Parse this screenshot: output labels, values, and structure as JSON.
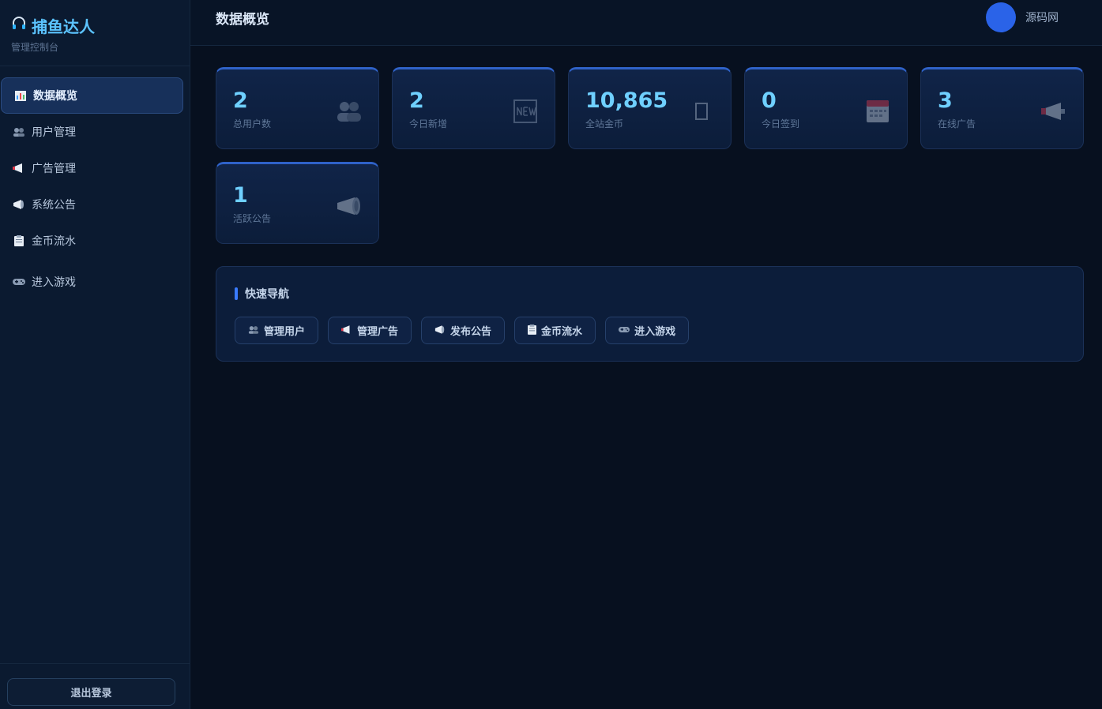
{
  "brand": {
    "title": "捕鱼达人",
    "subtitle": "管理控制台",
    "icon": "headset-icon"
  },
  "sidebar": {
    "items": [
      {
        "label": "数据概览",
        "icon": "chart-icon",
        "active": true
      },
      {
        "label": "用户管理",
        "icon": "users-icon"
      },
      {
        "label": "广告管理",
        "icon": "megaphone-icon"
      },
      {
        "label": "系统公告",
        "icon": "loudspeaker-icon"
      },
      {
        "label": "金币流水",
        "icon": "clipboard-icon"
      },
      {
        "label": "进入游戏",
        "icon": "gamepad-icon"
      }
    ],
    "logout_label": "退出登录"
  },
  "header": {
    "title": "数据概览",
    "username": "源码网"
  },
  "stats": [
    {
      "value": "2",
      "label": "总用户数",
      "icon": "users-icon"
    },
    {
      "value": "2",
      "label": "今日新增",
      "icon": "new-badge-icon"
    },
    {
      "value": "10,865",
      "label": "全站金币",
      "icon": "coin-icon"
    },
    {
      "value": "0",
      "label": "今日签到",
      "icon": "calendar-icon"
    },
    {
      "value": "3",
      "label": "在线广告",
      "icon": "megaphone-icon"
    },
    {
      "value": "1",
      "label": "活跃公告",
      "icon": "loudspeaker-icon"
    }
  ],
  "quick_nav": {
    "title": "快速导航",
    "buttons": [
      {
        "label": "管理用户",
        "icon": "users-icon"
      },
      {
        "label": "管理广告",
        "icon": "megaphone-icon"
      },
      {
        "label": "发布公告",
        "icon": "loudspeaker-icon"
      },
      {
        "label": "金币流水",
        "icon": "clipboard-icon"
      },
      {
        "label": "进入游戏",
        "icon": "gamepad-icon"
      }
    ]
  },
  "colors": {
    "accent": "#3a7bff",
    "stat_value": "#6fd0ff",
    "brand": "#5cc4ff",
    "avatar": "#2a63e8"
  }
}
